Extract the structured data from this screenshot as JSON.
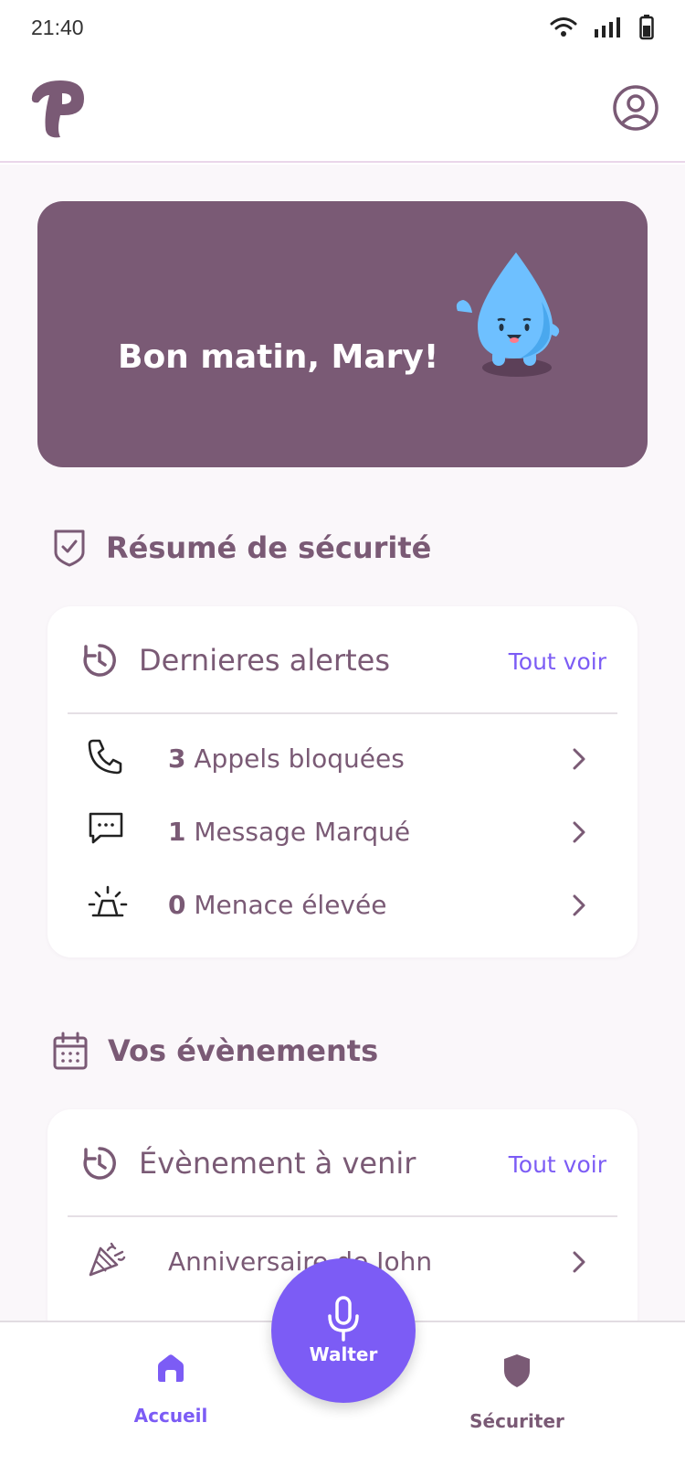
{
  "status_bar": {
    "time": "21:40"
  },
  "greeting": {
    "text": "Bon matin, Mary!"
  },
  "security": {
    "title": "Résumé de sécurité",
    "card_title": "Dernieres alertes",
    "see_all": "Tout voir",
    "items": [
      {
        "count": "3",
        "label": "Appels bloquées"
      },
      {
        "count": "1",
        "label": "Message Marqué"
      },
      {
        "count": "0",
        "label": "Menace élevée"
      }
    ]
  },
  "events": {
    "title": "Vos évènements",
    "card_title": "Évènement à venir",
    "see_all": "Tout voir",
    "items": [
      {
        "label": "Anniversaire de John"
      }
    ]
  },
  "fab": {
    "label": "Walter"
  },
  "nav": {
    "home_label": "Accueil",
    "security_label": "Sécuriter"
  },
  "colors": {
    "brand": "#7a5a75",
    "accent": "#7c5cf5",
    "background": "#faf7fa"
  }
}
